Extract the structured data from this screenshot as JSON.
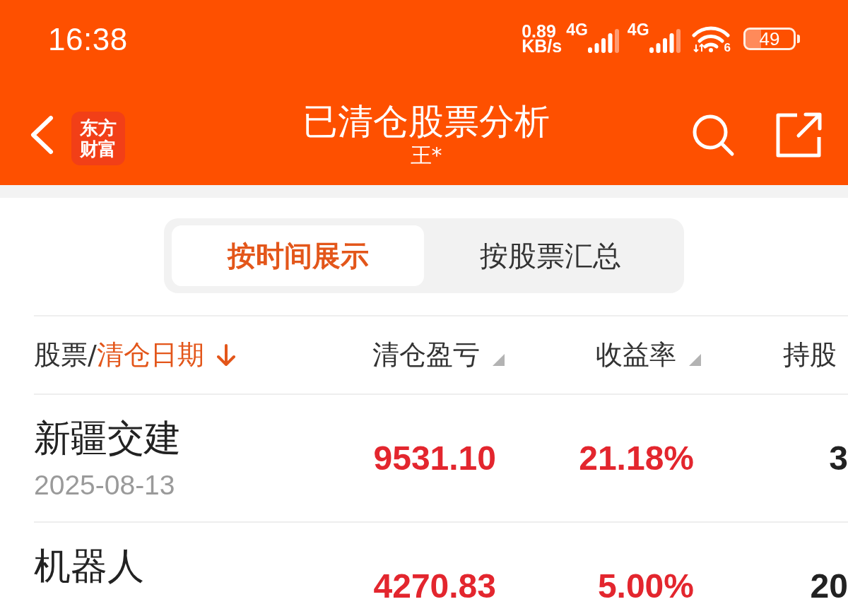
{
  "status_bar": {
    "time": "16:38",
    "net_speed": {
      "value": "0.89",
      "unit": "KB/s"
    },
    "networks": [
      {
        "label": "4G"
      },
      {
        "label": "4G"
      }
    ],
    "wifi": {
      "label": "6"
    },
    "battery": {
      "label": "49"
    }
  },
  "header": {
    "logo_lines": [
      "东方",
      "财富"
    ],
    "title": "已清仓股票分析",
    "subtitle": "王*"
  },
  "tabs": [
    {
      "label": "按时间展示",
      "selected": true
    },
    {
      "label": "按股票汇总",
      "selected": false
    }
  ],
  "table": {
    "columns": [
      {
        "label": "股票/",
        "sort_label": "清仓日期",
        "sorted": true
      },
      {
        "label": "清仓盈亏",
        "sorted": false
      },
      {
        "label": "收益率",
        "sorted": false
      },
      {
        "label": "持股"
      }
    ],
    "rows": [
      {
        "name": "新疆交建",
        "date": "2025-08-13",
        "profit": "9531.10",
        "return_rate": "21.18%",
        "holding_days": "3"
      },
      {
        "name": "机器人",
        "profit": "4270.83",
        "return_rate": "5.00%",
        "holding_days": "20"
      }
    ]
  }
}
